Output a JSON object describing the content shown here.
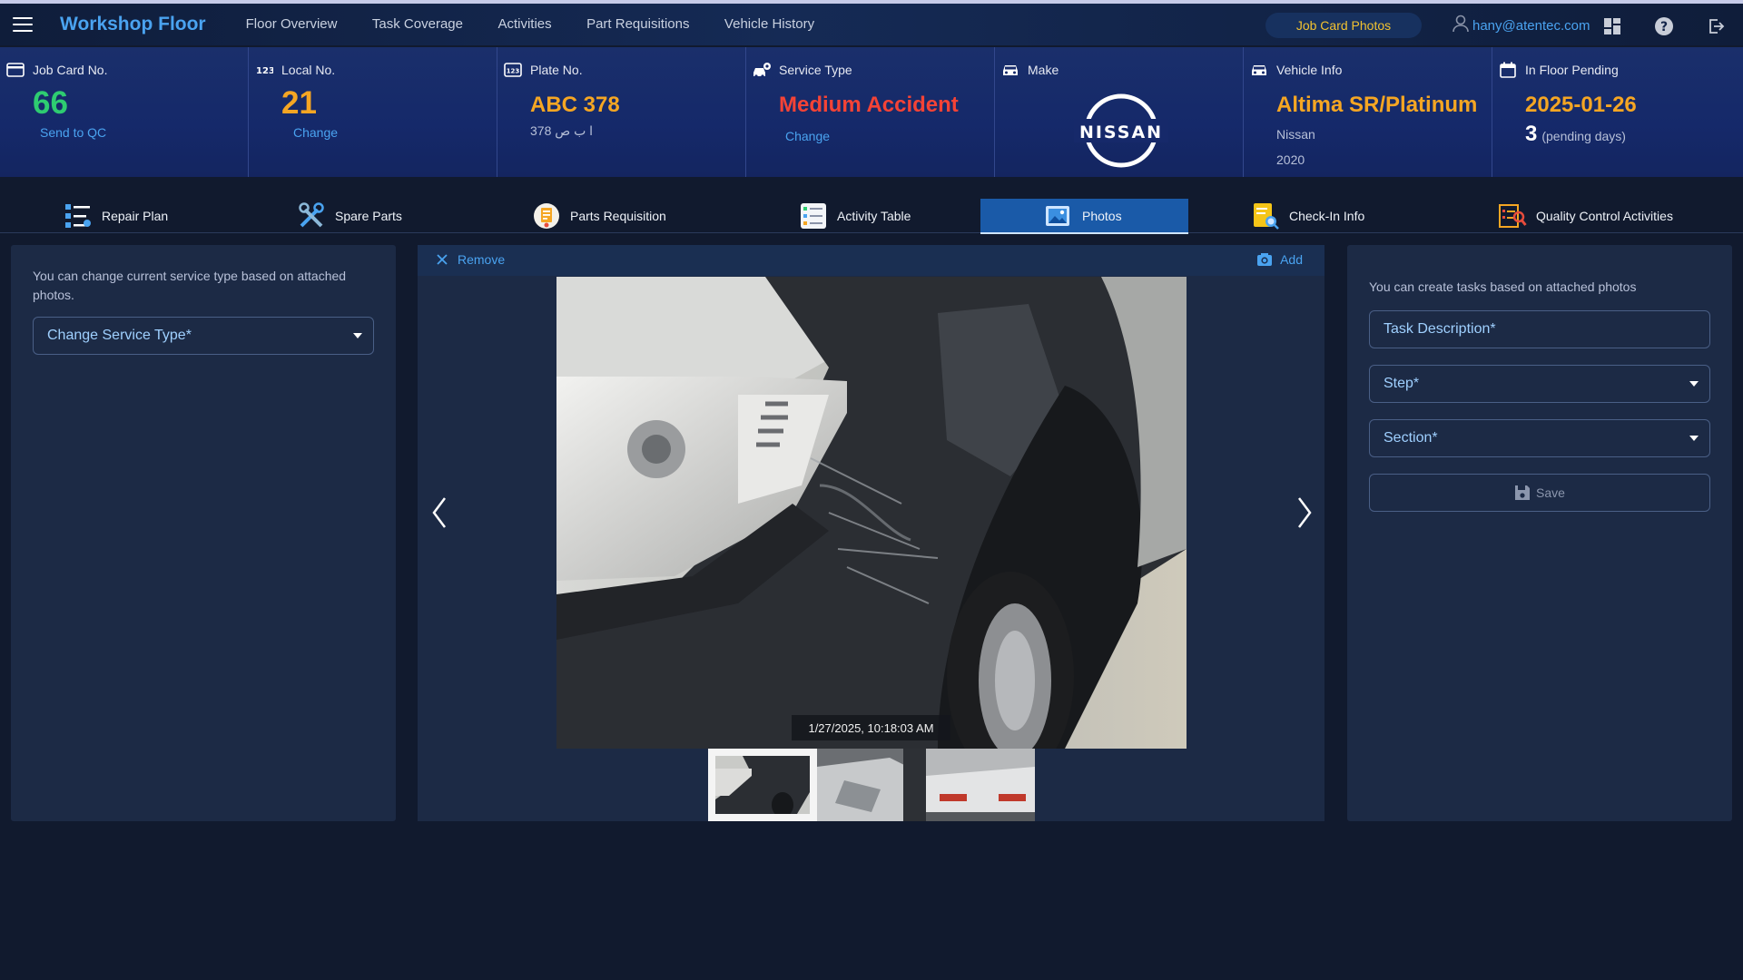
{
  "appbar": {
    "brand": "Workshop Floor",
    "nav": [
      "Floor Overview",
      "Task Coverage",
      "Activities",
      "Part Requisitions",
      "Vehicle History"
    ],
    "job_card_photos": "Job Card Photos",
    "user_email": "hany@atentec.com"
  },
  "cards": {
    "job_card": {
      "label": "Job Card No.",
      "value": "66",
      "link": "Send to QC"
    },
    "local": {
      "label": "Local No.",
      "value": "21",
      "link": "Change"
    },
    "plate": {
      "label": "Plate No.",
      "value": "ABC 378",
      "arabic": "378 ا ب ص"
    },
    "service": {
      "label": "Service Type",
      "value": "Medium Accident",
      "link": "Change"
    },
    "make": {
      "label": "Make",
      "logo_text": "NISSAN"
    },
    "vehicle": {
      "label": "Vehicle Info",
      "model": "Altima SR/Platinum",
      "brand": "Nissan",
      "year": "2020"
    },
    "pending": {
      "label": "In Floor Pending",
      "date": "2025-01-26",
      "days": "3",
      "days_label": "(pending days)"
    }
  },
  "tabs": [
    {
      "label": "Repair Plan",
      "icon": "repair-plan-icon"
    },
    {
      "label": "Spare Parts",
      "icon": "spare-parts-icon"
    },
    {
      "label": "Parts Requisition",
      "icon": "parts-requisition-icon"
    },
    {
      "label": "Activity Table",
      "icon": "activity-table-icon"
    },
    {
      "label": "Photos",
      "icon": "photos-icon"
    },
    {
      "label": "Check-In Info",
      "icon": "check-in-icon"
    },
    {
      "label": "Quality Control Activities",
      "icon": "quality-control-icon"
    }
  ],
  "left_panel": {
    "hint": "You can change current service type based on attached photos.",
    "service_select": "Change Service Type*"
  },
  "photo_panel": {
    "remove": "Remove",
    "add": "Add",
    "timestamp": "1/27/2025, 10:18:03 AM"
  },
  "right_panel": {
    "hint": "You can create tasks based on attached photos",
    "task_description": "Task Description*",
    "step": "Step*",
    "section": "Section*",
    "save": "Save"
  },
  "colors": {
    "accent": "#4aa3f0",
    "green": "#2ecc71",
    "orange": "#f5a623",
    "red": "#f44336",
    "active_tab": "#1a5aa8"
  }
}
